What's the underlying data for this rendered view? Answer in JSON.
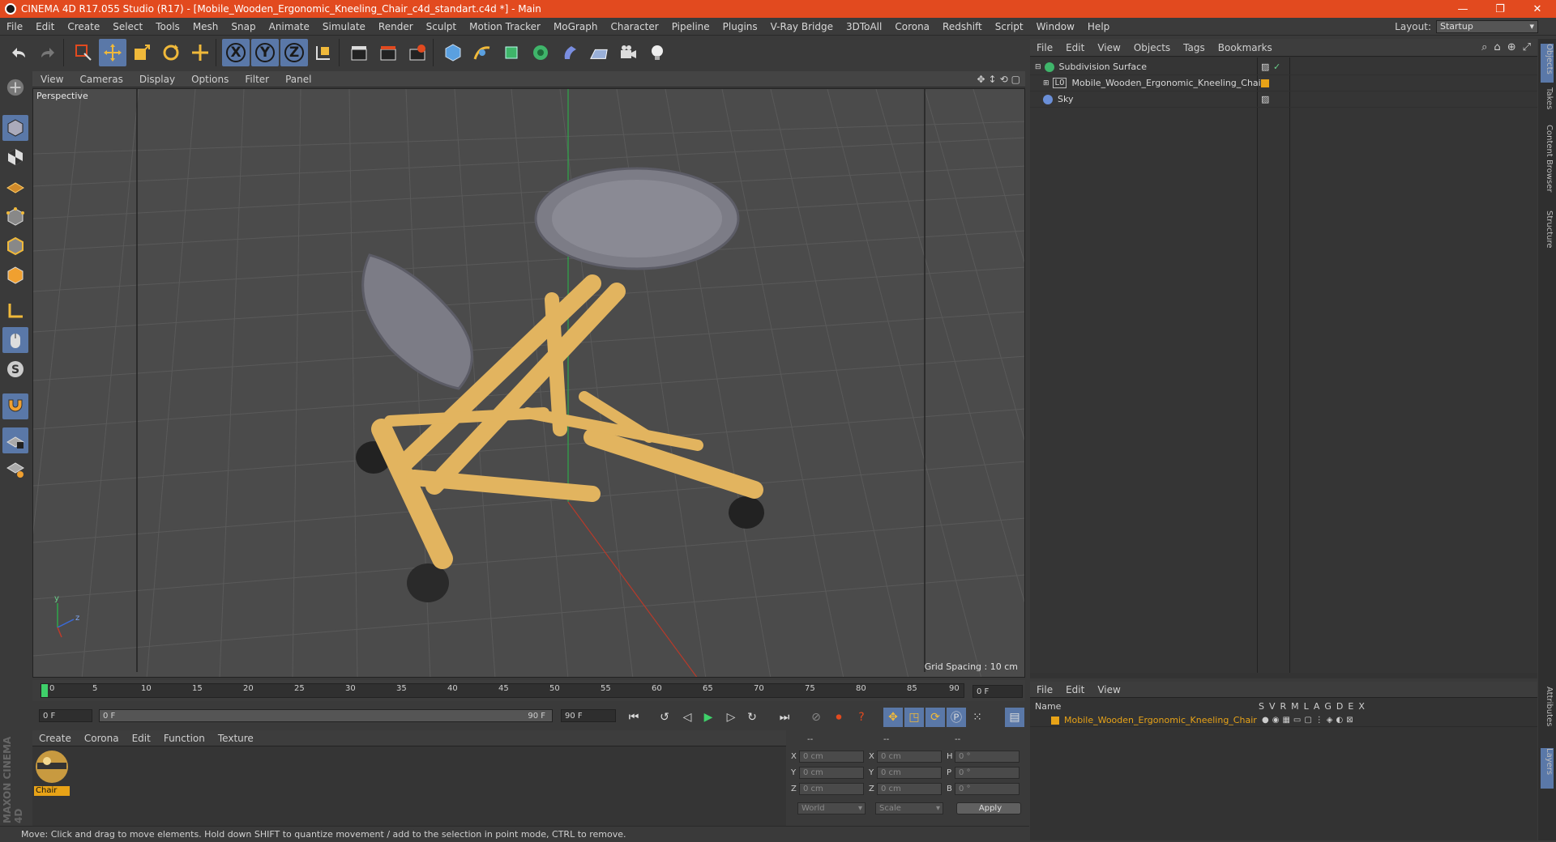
{
  "window": {
    "title": "CINEMA 4D R17.055 Studio (R17) - [Mobile_Wooden_Ergonomic_Kneeling_Chair_c4d_standart.c4d *] - Main",
    "min": "—",
    "restore": "❐",
    "close": "✕"
  },
  "menu": {
    "items": [
      "File",
      "Edit",
      "Create",
      "Select",
      "Tools",
      "Mesh",
      "Snap",
      "Animate",
      "Simulate",
      "Render",
      "Sculpt",
      "Motion Tracker",
      "MoGraph",
      "Character",
      "Pipeline",
      "Plugins",
      "V-Ray Bridge",
      "3DToAll",
      "Corona",
      "Redshift",
      "Script",
      "Window",
      "Help"
    ],
    "layout_label": "Layout:",
    "layout_value": "Startup"
  },
  "toolbar": {
    "x_label": "X",
    "y_label": "Y",
    "z_label": "Z"
  },
  "viewport": {
    "menu": [
      "View",
      "Cameras",
      "Display",
      "Options",
      "Filter",
      "Panel"
    ],
    "label": "Perspective",
    "grid_spacing": "Grid Spacing : 10 cm",
    "axis_y": "y",
    "axis_z": "z"
  },
  "objects": {
    "menu": [
      "File",
      "Edit",
      "View",
      "Objects",
      "Tags",
      "Bookmarks"
    ],
    "rows": [
      {
        "name": "Subdivision Surface"
      },
      {
        "name": "Mobile_Wooden_Ergonomic_Kneeling_Chair"
      },
      {
        "name": "Sky"
      }
    ]
  },
  "side_tabs": [
    "Objects",
    "Takes",
    "Content Browser",
    "Structure"
  ],
  "side_tabs_bottom": [
    "Attributes",
    "Layers"
  ],
  "timeline": {
    "ticks": [
      "0",
      "5",
      "10",
      "15",
      "20",
      "25",
      "30",
      "35",
      "40",
      "45",
      "50",
      "55",
      "60",
      "65",
      "70",
      "75",
      "80",
      "85",
      "90"
    ],
    "frame_field": "0 F",
    "start_field": "0 F",
    "range_start": "0 F",
    "range_end": "90 F",
    "end_field": "90 F"
  },
  "material": {
    "menu": [
      "Create",
      "Corona",
      "Edit",
      "Function",
      "Texture"
    ],
    "name": "Chair"
  },
  "coords": {
    "header": [
      "--",
      "--",
      "--"
    ],
    "rows": [
      {
        "a": "X",
        "av": "0 cm",
        "b": "X",
        "bv": "0 cm",
        "c": "H",
        "cv": "0 °"
      },
      {
        "a": "Y",
        "av": "0 cm",
        "b": "Y",
        "bv": "0 cm",
        "c": "P",
        "cv": "0 °"
      },
      {
        "a": "Z",
        "av": "0 cm",
        "b": "Z",
        "bv": "0 cm",
        "c": "B",
        "cv": "0 °"
      }
    ],
    "world": "World",
    "scale": "Scale",
    "apply": "Apply"
  },
  "layers": {
    "menu": [
      "File",
      "Edit",
      "View"
    ],
    "col_name": "Name",
    "cols": [
      "S",
      "V",
      "R",
      "M",
      "L",
      "A",
      "G",
      "D",
      "E",
      "X"
    ],
    "row": "Mobile_Wooden_Ergonomic_Kneeling_Chair"
  },
  "status": "Move: Click and drag to move elements. Hold down SHIFT to quantize movement / add to the selection in point mode, CTRL to remove.",
  "brand": "MAXON CINEMA 4D",
  "colors": {
    "title": "#e24a1f",
    "active": "#5a78a8",
    "wood": "#e2b45f",
    "cushion": "#7c7c86",
    "layer": "#e8a317"
  }
}
